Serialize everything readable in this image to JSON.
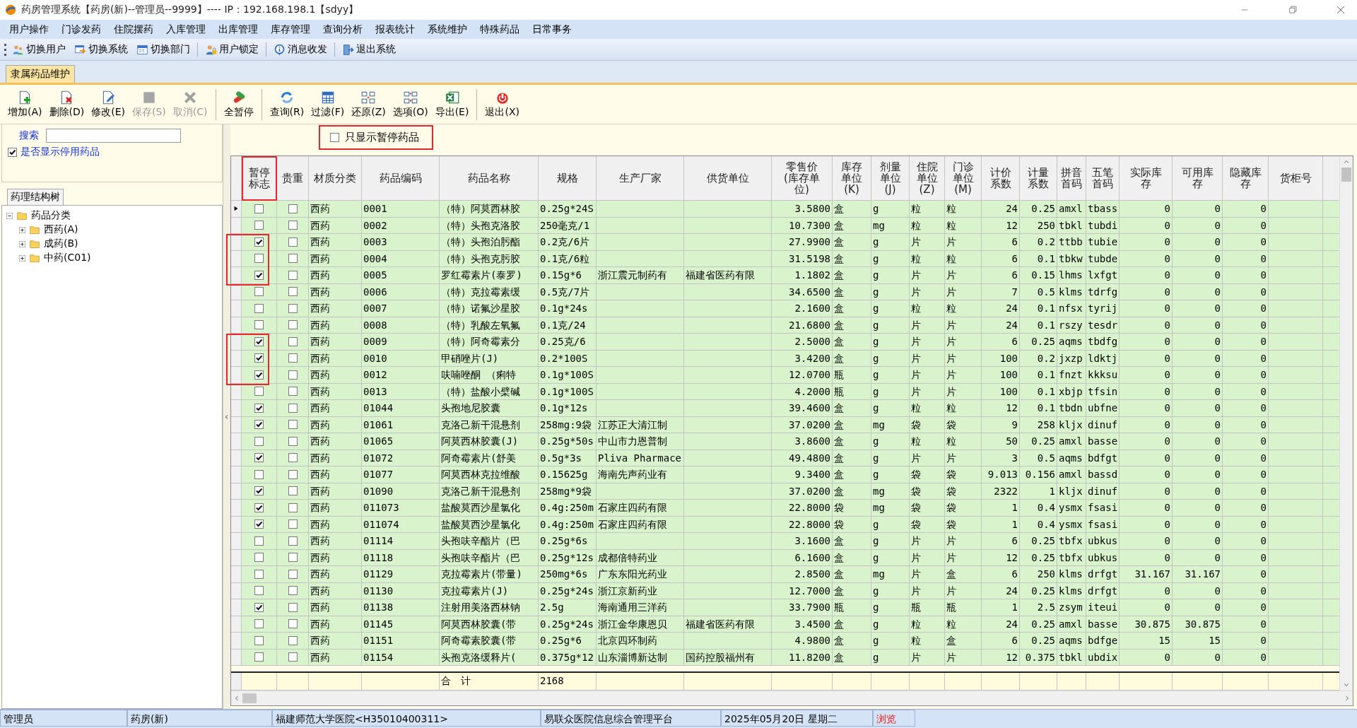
{
  "window": {
    "title": "药房管理系统【药房(新)--管理员--9999】---- IP：192.168.198.1【sdyy】"
  },
  "menu": [
    "用户操作",
    "门诊发药",
    "住院摆药",
    "入库管理",
    "出库管理",
    "库存管理",
    "查询分析",
    "报表统计",
    "系统维护",
    "特殊药品",
    "日常事务"
  ],
  "quick_toolbar": [
    {
      "label": "切换用户",
      "kind": "users",
      "separator_before": false
    },
    {
      "label": "切换系统",
      "kind": "system",
      "separator_before": false
    },
    {
      "label": "切换部门",
      "kind": "department",
      "separator_before": false
    },
    {
      "label": "用户锁定",
      "kind": "lock",
      "separator_before": true
    },
    {
      "label": "消息收发",
      "kind": "info",
      "separator_before": true
    },
    {
      "label": "退出系统",
      "kind": "door",
      "separator_before": true
    }
  ],
  "document_tab": {
    "label": "隶属药品维护",
    "selected": true
  },
  "toolbar": [
    {
      "label": "增加(A)",
      "kind": "add",
      "disabled": false,
      "separator_before": false
    },
    {
      "label": "删除(D)",
      "kind": "delete",
      "disabled": false,
      "separator_before": false
    },
    {
      "label": "修改(E)",
      "kind": "edit",
      "disabled": false,
      "separator_before": false
    },
    {
      "label": "保存(S)",
      "kind": "save",
      "disabled": true,
      "separator_before": false
    },
    {
      "label": "取消(C)",
      "kind": "cancel",
      "disabled": true,
      "separator_before": false
    },
    {
      "label": "全暂停",
      "kind": "pause",
      "disabled": false,
      "separator_before": true
    },
    {
      "label": "查询(R)",
      "kind": "query",
      "disabled": false,
      "separator_before": true
    },
    {
      "label": "过滤(F)",
      "kind": "filter",
      "disabled": false,
      "separator_before": false
    },
    {
      "label": "还原(Z)",
      "kind": "restore",
      "disabled": false,
      "separator_before": false
    },
    {
      "label": "选项(O)",
      "kind": "options",
      "disabled": false,
      "separator_before": false
    },
    {
      "label": "导出(E)",
      "kind": "export",
      "disabled": false,
      "separator_before": false
    },
    {
      "label": "退出(X)",
      "kind": "exit",
      "disabled": false,
      "separator_before": true
    }
  ],
  "left_panel": {
    "search_label": "搜索",
    "show_stopped": {
      "label": "是否显示停用药品",
      "checked": true
    },
    "tab": {
      "label": "药理结构树"
    },
    "tree": [
      {
        "label": "药品分类",
        "expanded": true,
        "children": [
          {
            "label": "西药(A)",
            "expanded": false
          },
          {
            "label": "成药(B)",
            "expanded": false
          },
          {
            "label": "中药(C01)",
            "expanded": false
          }
        ]
      }
    ]
  },
  "filter": {
    "label": "只显示暂停药品",
    "checked": false,
    "highlighted": true
  },
  "table": {
    "columns": [
      {
        "label": "暂停标志",
        "kind": "check",
        "highlighted": true
      },
      {
        "label": "贵重",
        "kind": "check",
        "highlighted": false
      },
      {
        "label": "材质分类",
        "kind": "text",
        "highlighted": false
      },
      {
        "label": "药品编码",
        "kind": "text",
        "highlighted": false
      },
      {
        "label": "药品名称",
        "kind": "text",
        "highlighted": false
      },
      {
        "label": "规格",
        "kind": "text",
        "highlighted": false
      },
      {
        "label": "生产厂家",
        "kind": "text",
        "highlighted": false
      },
      {
        "label": "供货单位",
        "kind": "text",
        "highlighted": false
      },
      {
        "label": "零售价(库存单位)",
        "kind": "number",
        "highlighted": false
      },
      {
        "label": "库存单位(K)",
        "kind": "text",
        "highlighted": false
      },
      {
        "label": "剂量单位(J)",
        "kind": "text",
        "highlighted": false
      },
      {
        "label": "住院单位(Z)",
        "kind": "text",
        "highlighted": false
      },
      {
        "label": "门诊单位(M)",
        "kind": "text",
        "highlighted": false
      },
      {
        "label": "计价系数",
        "kind": "number",
        "highlighted": false
      },
      {
        "label": "计量系数",
        "kind": "number",
        "highlighted": false
      },
      {
        "label": "拼音首码",
        "kind": "text",
        "highlighted": false
      },
      {
        "label": "五笔首码",
        "kind": "text",
        "highlighted": false
      },
      {
        "label": "实际库存",
        "kind": "number",
        "highlighted": false
      },
      {
        "label": "可用库存",
        "kind": "number",
        "highlighted": false
      },
      {
        "label": "隐藏库存",
        "kind": "number",
        "highlighted": false
      },
      {
        "label": "货柜号",
        "kind": "text",
        "highlighted": false
      }
    ],
    "rows": [
      {
        "current": true,
        "highlighted": false,
        "paused": false,
        "valuable": false,
        "category": "西药",
        "code": "0001",
        "name": "（特）阿莫西林胶",
        "spec": "0.25g*24S",
        "price": "3.5800",
        "stock_unit": "盒",
        "dose_unit": "g",
        "inpatient_unit": "粒",
        "outpatient_unit": "粒",
        "price_factor": "24",
        "dose_factor": "0.25",
        "pinyin": "amxl",
        "wubi": "tbass",
        "actual_stock": "0",
        "available_stock": "0",
        "hidden_stock": "0"
      },
      {
        "current": false,
        "highlighted": false,
        "paused": false,
        "valuable": false,
        "category": "西药",
        "code": "0002",
        "name": "（特）头孢克洛胶",
        "spec": "250毫克/1",
        "price": "10.7300",
        "stock_unit": "盒",
        "dose_unit": "mg",
        "inpatient_unit": "粒",
        "outpatient_unit": "粒",
        "price_factor": "12",
        "dose_factor": "250",
        "pinyin": "tbkl",
        "wubi": "tubdi",
        "actual_stock": "0",
        "available_stock": "0",
        "hidden_stock": "0"
      },
      {
        "current": false,
        "highlighted": true,
        "paused": true,
        "valuable": false,
        "category": "西药",
        "code": "0003",
        "name": "（特）头孢泊肟酯",
        "spec": "0.2克/6片",
        "price": "27.9900",
        "stock_unit": "盒",
        "dose_unit": "g",
        "inpatient_unit": "片",
        "outpatient_unit": "片",
        "price_factor": "6",
        "dose_factor": "0.2",
        "pinyin": "ttbb",
        "wubi": "tubie",
        "actual_stock": "0",
        "available_stock": "0",
        "hidden_stock": "0"
      },
      {
        "current": false,
        "highlighted": true,
        "paused": false,
        "valuable": false,
        "category": "西药",
        "code": "0004",
        "name": "（特）头孢克肟胶",
        "spec": "0.1克/6粒",
        "price": "31.5198",
        "stock_unit": "盒",
        "dose_unit": "g",
        "inpatient_unit": "粒",
        "outpatient_unit": "粒",
        "price_factor": "6",
        "dose_factor": "0.1",
        "pinyin": "tbkw",
        "wubi": "tubde",
        "actual_stock": "0",
        "available_stock": "0",
        "hidden_stock": "0"
      },
      {
        "current": false,
        "highlighted": true,
        "paused": true,
        "valuable": false,
        "category": "西药",
        "code": "0005",
        "name": "罗红霉素片(泰罗)",
        "spec": "0.15g*6",
        "maker": "浙江震元制药有",
        "supplier": "福建省医药有限",
        "price": "1.1802",
        "stock_unit": "盒",
        "dose_unit": "g",
        "inpatient_unit": "片",
        "outpatient_unit": "片",
        "price_factor": "6",
        "dose_factor": "0.15",
        "pinyin": "lhms",
        "wubi": "lxfgt",
        "actual_stock": "0",
        "available_stock": "0",
        "hidden_stock": "0"
      },
      {
        "current": false,
        "highlighted": false,
        "paused": false,
        "valuable": false,
        "category": "西药",
        "code": "0006",
        "name": "（特）克拉霉素缓",
        "spec": "0.5克/7片",
        "price": "34.6500",
        "stock_unit": "盒",
        "dose_unit": "g",
        "inpatient_unit": "片",
        "outpatient_unit": "片",
        "price_factor": "7",
        "dose_factor": "0.5",
        "pinyin": "klms",
        "wubi": "tdrfg",
        "actual_stock": "0",
        "available_stock": "0",
        "hidden_stock": "0"
      },
      {
        "current": false,
        "highlighted": false,
        "paused": false,
        "valuable": false,
        "category": "西药",
        "code": "0007",
        "name": "（特）诺氟沙星胶",
        "spec": "0.1g*24s",
        "price": "2.1600",
        "stock_unit": "盒",
        "dose_unit": "g",
        "inpatient_unit": "粒",
        "outpatient_unit": "粒",
        "price_factor": "24",
        "dose_factor": "0.1",
        "pinyin": "nfsx",
        "wubi": "tyrij",
        "actual_stock": "0",
        "available_stock": "0",
        "hidden_stock": "0"
      },
      {
        "current": false,
        "highlighted": false,
        "paused": false,
        "valuable": false,
        "category": "西药",
        "code": "0008",
        "name": "（特）乳酸左氧氟",
        "spec": "0.1克/24",
        "price": "21.6800",
        "stock_unit": "盒",
        "dose_unit": "g",
        "inpatient_unit": "片",
        "outpatient_unit": "片",
        "price_factor": "24",
        "dose_factor": "0.1",
        "pinyin": "rszy",
        "wubi": "tesdr",
        "actual_stock": "0",
        "available_stock": "0",
        "hidden_stock": "0"
      },
      {
        "current": false,
        "highlighted": true,
        "paused": true,
        "valuable": false,
        "category": "西药",
        "code": "0009",
        "name": "（特）阿奇霉素分",
        "spec": "0.25克/6",
        "price": "2.5000",
        "stock_unit": "盒",
        "dose_unit": "g",
        "inpatient_unit": "片",
        "outpatient_unit": "片",
        "price_factor": "6",
        "dose_factor": "0.25",
        "pinyin": "aqms",
        "wubi": "tbdfg",
        "actual_stock": "0",
        "available_stock": "0",
        "hidden_stock": "0"
      },
      {
        "current": false,
        "highlighted": true,
        "paused": true,
        "valuable": false,
        "category": "西药",
        "code": "0010",
        "name": "甲硝唑片(J)",
        "spec": "0.2*100S",
        "price": "3.4200",
        "stock_unit": "盒",
        "dose_unit": "g",
        "inpatient_unit": "片",
        "outpatient_unit": "片",
        "price_factor": "100",
        "dose_factor": "0.2",
        "pinyin": "jxzp",
        "wubi": "ldktj",
        "actual_stock": "0",
        "available_stock": "0",
        "hidden_stock": "0"
      },
      {
        "current": false,
        "highlighted": true,
        "paused": true,
        "valuable": false,
        "category": "西药",
        "code": "0012",
        "name": "呋喃唑酮 （痢特",
        "spec": "0.1g*100S",
        "price": "12.0700",
        "stock_unit": "瓶",
        "dose_unit": "g",
        "inpatient_unit": "片",
        "outpatient_unit": "片",
        "price_factor": "100",
        "dose_factor": "0.1",
        "pinyin": "fnzt",
        "wubi": "kkksu",
        "actual_stock": "0",
        "available_stock": "0",
        "hidden_stock": "0"
      },
      {
        "current": false,
        "highlighted": false,
        "paused": false,
        "valuable": false,
        "category": "西药",
        "code": "0013",
        "name": "（特）盐酸小檗碱",
        "spec": "0.1g*100S",
        "price": "4.2000",
        "stock_unit": "瓶",
        "dose_unit": "g",
        "inpatient_unit": "片",
        "outpatient_unit": "片",
        "price_factor": "100",
        "dose_factor": "0.1",
        "pinyin": "xbjp",
        "wubi": "tfsin",
        "actual_stock": "0",
        "available_stock": "0",
        "hidden_stock": "0"
      },
      {
        "current": false,
        "highlighted": false,
        "paused": true,
        "valuable": false,
        "category": "西药",
        "code": "01044",
        "name": "头孢地尼胶囊",
        "spec": "0.1g*12s",
        "price": "39.4600",
        "stock_unit": "盒",
        "dose_unit": "g",
        "inpatient_unit": "粒",
        "outpatient_unit": "粒",
        "price_factor": "12",
        "dose_factor": "0.1",
        "pinyin": "tbdn",
        "wubi": "ubfne",
        "actual_stock": "0",
        "available_stock": "0",
        "hidden_stock": "0"
      },
      {
        "current": false,
        "highlighted": false,
        "paused": true,
        "valuable": false,
        "category": "西药",
        "code": "01061",
        "name": "克洛己新干混悬剂",
        "spec": "258mg:9袋",
        "maker": "江苏正大清江制",
        "price": "37.0200",
        "stock_unit": "盒",
        "dose_unit": "mg",
        "inpatient_unit": "袋",
        "outpatient_unit": "袋",
        "price_factor": "9",
        "dose_factor": "258",
        "pinyin": "kljx",
        "wubi": "dinuf",
        "actual_stock": "0",
        "available_stock": "0",
        "hidden_stock": "0"
      },
      {
        "current": false,
        "highlighted": false,
        "paused": false,
        "valuable": false,
        "category": "西药",
        "code": "01065",
        "name": "阿莫西林胶囊(J)",
        "spec": "0.25g*50s",
        "maker": "中山市力恩普制",
        "price": "3.8600",
        "stock_unit": "盒",
        "dose_unit": "g",
        "inpatient_unit": "粒",
        "outpatient_unit": "粒",
        "price_factor": "50",
        "dose_factor": "0.25",
        "pinyin": "amxl",
        "wubi": "basse",
        "actual_stock": "0",
        "available_stock": "0",
        "hidden_stock": "0"
      },
      {
        "current": false,
        "highlighted": false,
        "paused": true,
        "valuable": false,
        "category": "西药",
        "code": "01072",
        "name": "阿奇霉素片(舒美",
        "spec": "0.5g*3s",
        "maker": "Pliva Pharmace",
        "price": "49.4800",
        "stock_unit": "盒",
        "dose_unit": "g",
        "inpatient_unit": "片",
        "outpatient_unit": "片",
        "price_factor": "3",
        "dose_factor": "0.5",
        "pinyin": "aqms",
        "wubi": "bdfgt",
        "actual_stock": "0",
        "available_stock": "0",
        "hidden_stock": "0"
      },
      {
        "current": false,
        "highlighted": false,
        "paused": false,
        "valuable": false,
        "category": "西药",
        "code": "01077",
        "name": "阿莫西林克拉维酸",
        "spec": "0.15625g",
        "maker": "海南先声药业有",
        "price": "9.3400",
        "stock_unit": "盒",
        "dose_unit": "g",
        "inpatient_unit": "袋",
        "outpatient_unit": "袋",
        "price_factor": "9.013",
        "dose_factor": "0.156",
        "pinyin": "amxl",
        "wubi": "bassd",
        "actual_stock": "0",
        "available_stock": "0",
        "hidden_stock": "0"
      },
      {
        "current": false,
        "highlighted": false,
        "paused": true,
        "valuable": false,
        "category": "西药",
        "code": "01090",
        "name": "克洛己新干混悬剂",
        "spec": "258mg*9袋",
        "price": "37.0200",
        "stock_unit": "盒",
        "dose_unit": "mg",
        "inpatient_unit": "袋",
        "outpatient_unit": "袋",
        "price_factor": "2322",
        "dose_factor": "1",
        "pinyin": "kljx",
        "wubi": "dinuf",
        "actual_stock": "0",
        "available_stock": "0",
        "hidden_stock": "0"
      },
      {
        "current": false,
        "highlighted": false,
        "paused": true,
        "valuable": false,
        "category": "西药",
        "code": "011073",
        "name": "盐酸莫西沙星氯化",
        "spec": "0.4g:250m",
        "maker": "石家庄四药有限",
        "price": "22.8000",
        "stock_unit": "袋",
        "dose_unit": "mg",
        "inpatient_unit": "袋",
        "outpatient_unit": "袋",
        "price_factor": "1",
        "dose_factor": "0.4",
        "pinyin": "ysmx",
        "wubi": "fsasi",
        "actual_stock": "0",
        "available_stock": "0",
        "hidden_stock": "0"
      },
      {
        "current": false,
        "highlighted": false,
        "paused": true,
        "valuable": false,
        "category": "西药",
        "code": "011074",
        "name": "盐酸莫西沙星氯化",
        "spec": "0.4g:250m",
        "maker": "石家庄四药有限",
        "price": "22.8000",
        "stock_unit": "袋",
        "dose_unit": "g",
        "inpatient_unit": "袋",
        "outpatient_unit": "袋",
        "price_factor": "1",
        "dose_factor": "0.4",
        "pinyin": "ysmx",
        "wubi": "fsasi",
        "actual_stock": "0",
        "available_stock": "0",
        "hidden_stock": "0"
      },
      {
        "current": false,
        "highlighted": false,
        "paused": false,
        "valuable": false,
        "category": "西药",
        "code": "01114",
        "name": "头孢呋辛酯片（巴",
        "spec": "0.25g*6s",
        "price": "3.1600",
        "stock_unit": "盒",
        "dose_unit": "g",
        "inpatient_unit": "片",
        "outpatient_unit": "片",
        "price_factor": "6",
        "dose_factor": "0.25",
        "pinyin": "tbfx",
        "wubi": "ubkus",
        "actual_stock": "0",
        "available_stock": "0",
        "hidden_stock": "0"
      },
      {
        "current": false,
        "highlighted": false,
        "paused": false,
        "valuable": false,
        "category": "西药",
        "code": "01118",
        "name": "头孢呋辛酯片（巴",
        "spec": "0.25g*12s",
        "maker": "成都倍特药业",
        "price": "6.1600",
        "stock_unit": "盒",
        "dose_unit": "g",
        "inpatient_unit": "片",
        "outpatient_unit": "片",
        "price_factor": "12",
        "dose_factor": "0.25",
        "pinyin": "tbfx",
        "wubi": "ubkus",
        "actual_stock": "0",
        "available_stock": "0",
        "hidden_stock": "0"
      },
      {
        "current": false,
        "highlighted": false,
        "paused": false,
        "valuable": false,
        "category": "西药",
        "code": "01129",
        "name": "克拉霉素片(带量)",
        "spec": "250mg*6s",
        "maker": "广东东阳光药业",
        "price": "2.8500",
        "stock_unit": "盒",
        "dose_unit": "mg",
        "inpatient_unit": "片",
        "outpatient_unit": "盒",
        "price_factor": "6",
        "dose_factor": "250",
        "pinyin": "klms",
        "wubi": "drfgt",
        "actual_stock": "31.167",
        "available_stock": "31.167",
        "hidden_stock": "0"
      },
      {
        "current": false,
        "highlighted": false,
        "paused": false,
        "valuable": false,
        "category": "西药",
        "code": "01130",
        "name": "克拉霉素片(J)",
        "spec": "0.25g*24s",
        "maker": "浙江京新药业",
        "price": "12.7000",
        "stock_unit": "盒",
        "dose_unit": "g",
        "inpatient_unit": "片",
        "outpatient_unit": "片",
        "price_factor": "24",
        "dose_factor": "0.25",
        "pinyin": "klms",
        "wubi": "drfgt",
        "actual_stock": "0",
        "available_stock": "0",
        "hidden_stock": "0"
      },
      {
        "current": false,
        "highlighted": false,
        "paused": true,
        "valuable": false,
        "category": "西药",
        "code": "01138",
        "name": "注射用美洛西林钠",
        "spec": "2.5g",
        "maker": "海南通用三洋药",
        "price": "33.7900",
        "stock_unit": "瓶",
        "dose_unit": "g",
        "inpatient_unit": "瓶",
        "outpatient_unit": "瓶",
        "price_factor": "1",
        "dose_factor": "2.5",
        "pinyin": "zsym",
        "wubi": "iteui",
        "actual_stock": "0",
        "available_stock": "0",
        "hidden_stock": "0"
      },
      {
        "current": false,
        "highlighted": false,
        "paused": false,
        "valuable": false,
        "category": "西药",
        "code": "01145",
        "name": "阿莫西林胶囊(带",
        "spec": "0.25g*24s",
        "maker": "浙江金华康恩贝",
        "supplier": "福建省医药有限",
        "price": "3.4500",
        "stock_unit": "盒",
        "dose_unit": "g",
        "inpatient_unit": "粒",
        "outpatient_unit": "粒",
        "price_factor": "24",
        "dose_factor": "0.25",
        "pinyin": "amxl",
        "wubi": "basse",
        "actual_stock": "30.875",
        "available_stock": "30.875",
        "hidden_stock": "0"
      },
      {
        "current": false,
        "highlighted": false,
        "paused": false,
        "valuable": false,
        "category": "西药",
        "code": "01151",
        "name": "阿奇霉素胶囊(带",
        "spec": "0.25g*6",
        "maker": "北京四环制药",
        "price": "4.9800",
        "stock_unit": "盒",
        "dose_unit": "g",
        "inpatient_unit": "粒",
        "outpatient_unit": "盒",
        "price_factor": "6",
        "dose_factor": "0.25",
        "pinyin": "aqms",
        "wubi": "bdfge",
        "actual_stock": "15",
        "available_stock": "15",
        "hidden_stock": "0"
      },
      {
        "current": false,
        "highlighted": false,
        "paused": false,
        "valuable": false,
        "category": "西药",
        "code": "01154",
        "name": "头孢克洛缓释片(",
        "spec": "0.375g*12",
        "maker": "山东淄博新达制",
        "supplier": "国药控股福州有",
        "price": "11.8200",
        "stock_unit": "盒",
        "dose_unit": "g",
        "inpatient_unit": "片",
        "outpatient_unit": "片",
        "price_factor": "12",
        "dose_factor": "0.375",
        "pinyin": "tbkl",
        "wubi": "ubdix",
        "actual_stock": "0",
        "available_stock": "0",
        "hidden_stock": "0"
      }
    ],
    "footer": {
      "name": "合　计",
      "spec": "2168"
    }
  },
  "status_bar": [
    {
      "text": "管理员",
      "kind": "plain"
    },
    {
      "text": "药房(新)",
      "kind": "plain"
    },
    {
      "text": "福建师范大学医院<H35010400311>",
      "kind": "plain"
    },
    {
      "text": "易联众医院信息综合管理平台",
      "kind": "plain"
    },
    {
      "text": "2025年05月20日 星期二",
      "kind": "plain"
    },
    {
      "text": "浏览",
      "kind": "mode"
    }
  ]
}
